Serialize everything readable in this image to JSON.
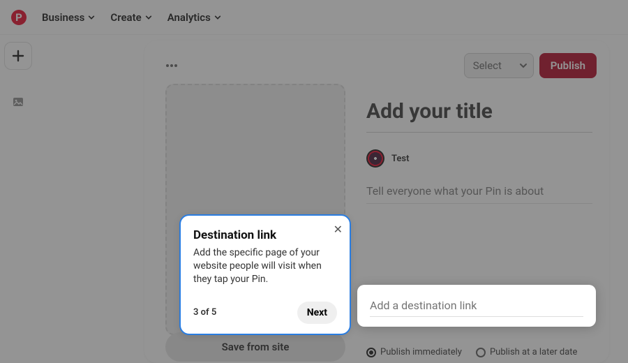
{
  "nav": {
    "logo_letter": "P",
    "items": [
      "Business",
      "Create",
      "Analytics"
    ]
  },
  "card": {
    "select_label": "Select",
    "publish_label": "Publish",
    "save_from_site": "Save from site"
  },
  "form": {
    "title_placeholder": "Add your title",
    "user_name": "Test",
    "desc_placeholder": "Tell everyone what your Pin is about",
    "dest_placeholder": "Add a destination link"
  },
  "publish_options": {
    "immediate": "Publish immediately",
    "later": "Publish at a later date"
  },
  "popover": {
    "title": "Destination link",
    "body": "Add the specific page of your website people will visit when they tap your Pin.",
    "step": "3 of 5",
    "next": "Next"
  },
  "colors": {
    "brand_red": "#e60023",
    "highlight_blue": "#2a7de1"
  }
}
